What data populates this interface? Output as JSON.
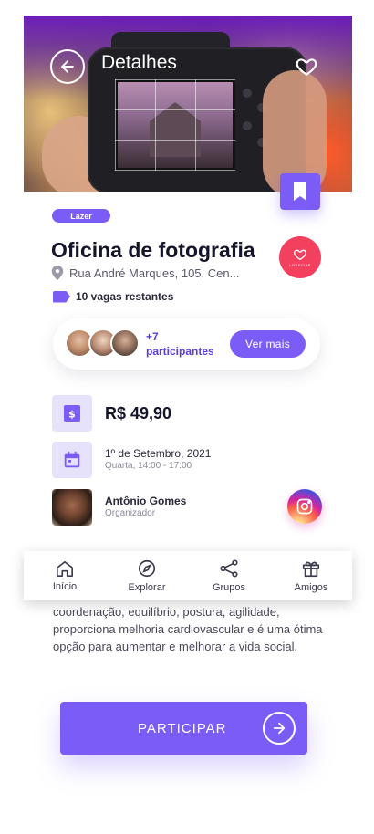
{
  "header": {
    "title": "Detalhes",
    "back_icon": "arrow-left-icon",
    "favorite_icon": "heart-icon"
  },
  "event": {
    "category": "Lazer",
    "name": "Oficina de fotografia",
    "address": "Rua André Marques, 105, Cen...",
    "spots": "10 vagas restantes",
    "brand_logo_text": "LOVECLIP",
    "price": "R$ 49,90",
    "date": "1º de Setembro, 2021",
    "time": "Quarta, 14:00 - 17:00"
  },
  "participants": {
    "count": "+7",
    "label": "participantes",
    "button": "Ver mais"
  },
  "organizer": {
    "name": "Antônio Gomes",
    "role": "Organizador"
  },
  "nav": {
    "items": [
      {
        "label": "Início",
        "icon": "home-icon"
      },
      {
        "label": "Explorar",
        "icon": "compass-icon"
      },
      {
        "label": "Grupos",
        "icon": "share-icon"
      },
      {
        "label": "Amigos",
        "icon": "gift-icon"
      }
    ]
  },
  "description": "coordenação, equilíbrio, postura, agilidade, proporciona melhoria cardiovascular e é uma ótima opção para aumentar e melhorar a vida social.",
  "cta": {
    "label": "PARTICIPAR"
  },
  "colors": {
    "accent": "#7c5cf7",
    "accent_light": "#e7e2fc",
    "brand_red": "#f4405f"
  }
}
